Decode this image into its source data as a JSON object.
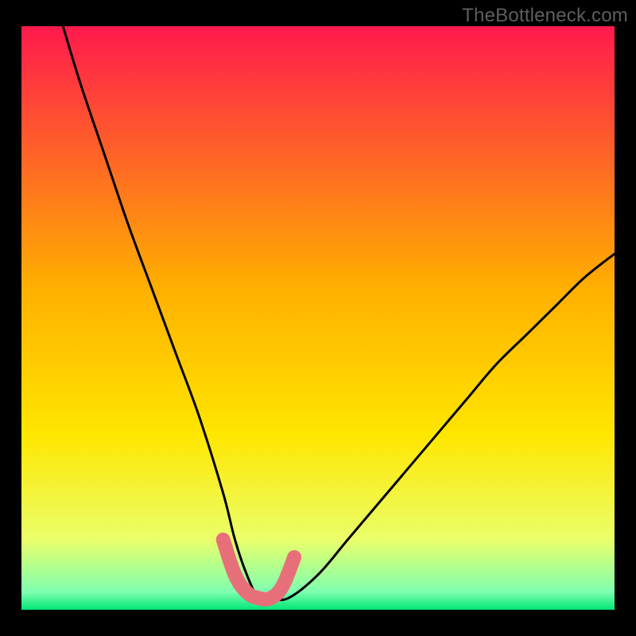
{
  "watermark": "TheBottleneck.com",
  "colors": {
    "bg_black": "#000000",
    "gradient_top": "#ff1a4d",
    "gradient_mid": "#ffd400",
    "gradient_bottom": "#00e676",
    "curve_stroke": "#000000",
    "highlight_stroke": "#e76f79"
  },
  "chart_data": {
    "type": "line",
    "title": "",
    "xlabel": "",
    "ylabel": "",
    "xlim": [
      0,
      100
    ],
    "ylim": [
      0,
      100
    ],
    "series": [
      {
        "name": "bottleneck-curve",
        "x": [
          7,
          10,
          14,
          18,
          22,
          26,
          30,
          34,
          36,
          38,
          40,
          42,
          45,
          50,
          55,
          60,
          65,
          70,
          75,
          80,
          85,
          90,
          95,
          100
        ],
        "y": [
          100,
          90,
          78,
          66,
          55,
          44,
          33,
          20,
          12,
          6,
          2,
          2,
          2,
          6,
          12,
          18,
          24,
          30,
          36,
          42,
          47,
          52,
          57,
          61
        ]
      }
    ],
    "highlight": {
      "name": "valley-highlight",
      "x": [
        34,
        36,
        38,
        40,
        42,
        44,
        46
      ],
      "y": [
        12,
        6,
        3,
        2,
        2,
        4,
        9
      ]
    },
    "gradient_stops": [
      {
        "offset": 0.0,
        "color": "#ff1a4d"
      },
      {
        "offset": 0.45,
        "color": "#ffb000"
      },
      {
        "offset": 0.7,
        "color": "#ffe600"
      },
      {
        "offset": 0.88,
        "color": "#eaff6a"
      },
      {
        "offset": 0.97,
        "color": "#7dffb0"
      },
      {
        "offset": 1.0,
        "color": "#00e676"
      }
    ]
  }
}
